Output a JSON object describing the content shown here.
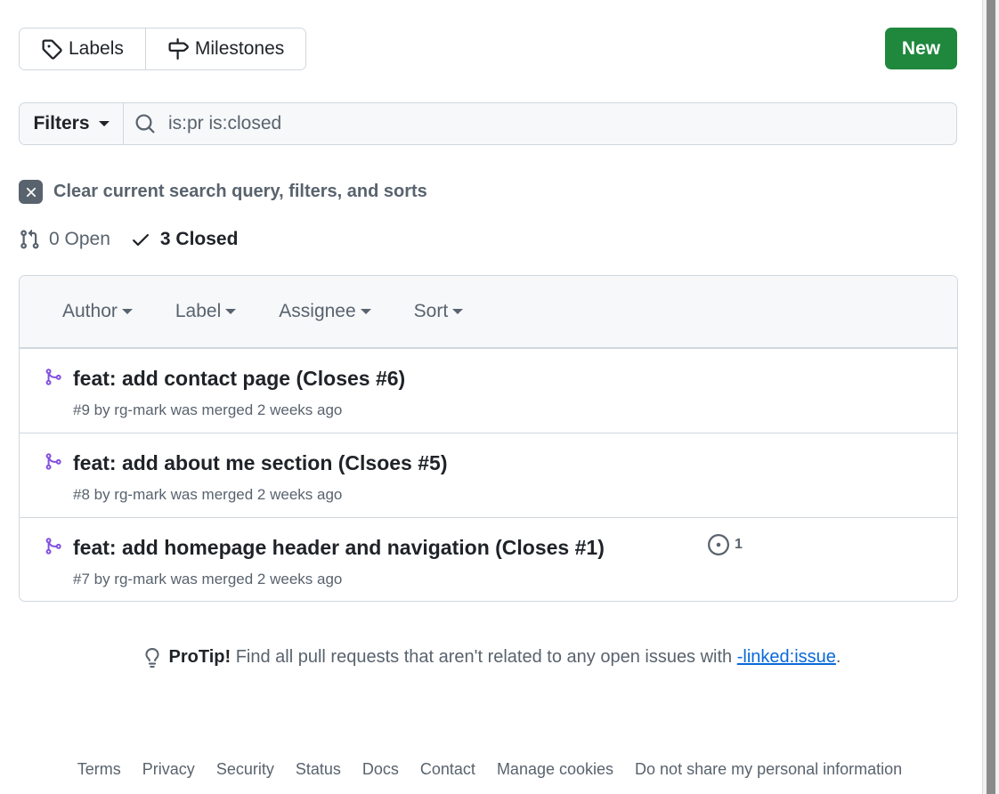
{
  "toolbar": {
    "labels": "Labels",
    "milestones": "Milestones",
    "new": "New"
  },
  "search": {
    "filters": "Filters",
    "query": "is:pr is:closed"
  },
  "clear_text": "Clear current search query, filters, and sorts",
  "states": {
    "open": "0 Open",
    "closed": "3 Closed"
  },
  "header": {
    "author": "Author",
    "label": "Label",
    "assignee": "Assignee",
    "sort": "Sort"
  },
  "pull_requests": [
    {
      "title": "feat: add contact page (Closes #6)",
      "meta": "#9 by rg-mark was merged 2 weeks ago"
    },
    {
      "title": "feat: add about me section (Clsoes #5)",
      "meta": "#8 by rg-mark was merged 2 weeks ago"
    },
    {
      "title": "feat: add homepage header and navigation (Closes #1)",
      "meta": "#7 by rg-mark was merged 2 weeks ago",
      "linked_issues": "1"
    }
  ],
  "protip": {
    "label": "ProTip!",
    "text": " Find all pull requests that aren't related to any open issues with ",
    "link": "-linked:issue",
    "end": "."
  },
  "footer": [
    "Terms",
    "Privacy",
    "Security",
    "Status",
    "Docs",
    "Contact",
    "Manage cookies",
    "Do not share my personal information"
  ],
  "colors": {
    "accent_green": "#1f883d",
    "merged_purple": "#8250df",
    "link_blue": "#0969da"
  }
}
